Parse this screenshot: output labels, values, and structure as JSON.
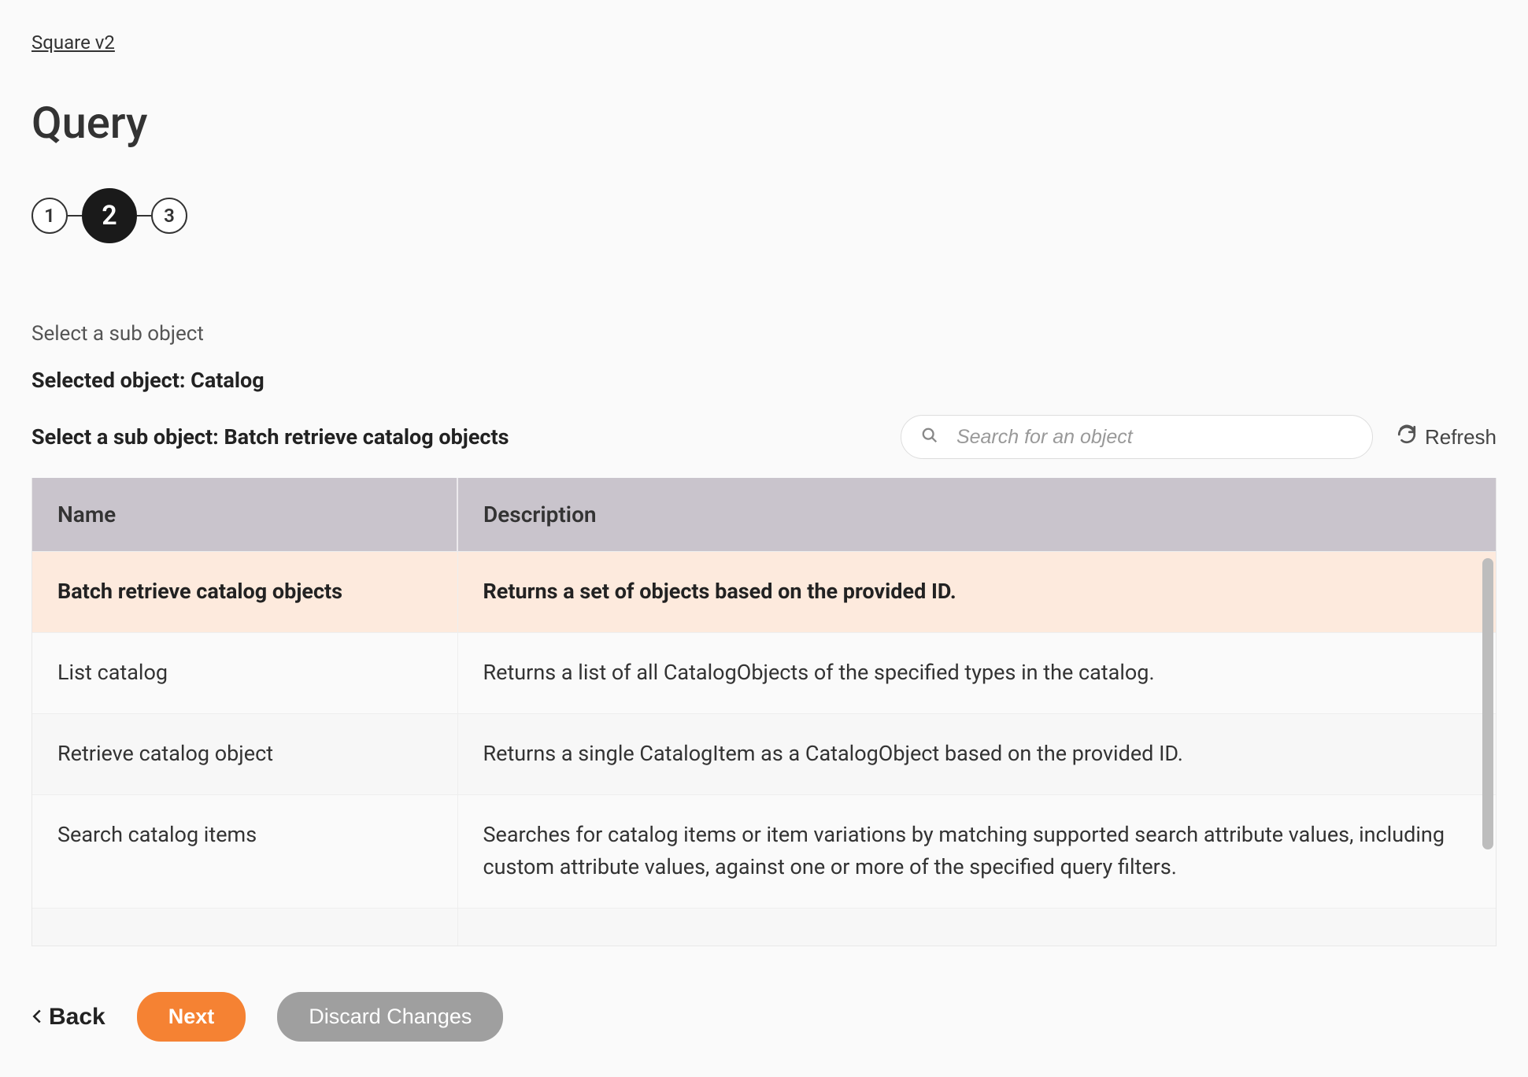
{
  "breadcrumb": "Square v2",
  "title": "Query",
  "stepper": {
    "steps": [
      "1",
      "2",
      "3"
    ],
    "active_index": 1
  },
  "meta": {
    "instruction": "Select a sub object",
    "selected_label": "Selected object: Catalog",
    "sub_label": "Select a sub object: Batch retrieve catalog objects"
  },
  "search": {
    "placeholder": "Search for an object"
  },
  "refresh_label": "Refresh",
  "table": {
    "headers": {
      "name": "Name",
      "description": "Description"
    },
    "rows": [
      {
        "name": "Batch retrieve catalog objects",
        "description": "Returns a set of objects based on the provided ID.",
        "selected": true
      },
      {
        "name": "List catalog",
        "description": "Returns a list of all CatalogObjects of the specified types in the catalog.",
        "selected": false
      },
      {
        "name": "Retrieve catalog object",
        "description": "Returns a single CatalogItem as a CatalogObject based on the provided ID.",
        "selected": false
      },
      {
        "name": "Search catalog items",
        "description": "Searches for catalog items or item variations by matching supported search attribute values, including custom attribute values, against one or more of the specified query filters.",
        "selected": false
      }
    ]
  },
  "footer": {
    "back": "Back",
    "next": "Next",
    "discard": "Discard Changes"
  }
}
